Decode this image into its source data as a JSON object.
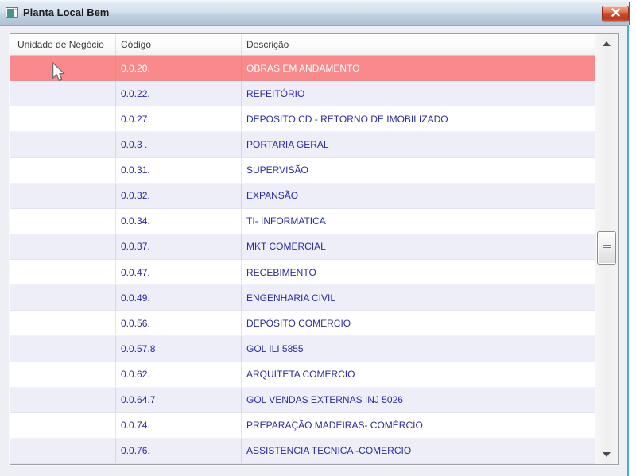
{
  "window": {
    "title": "Planta Local Bem",
    "close_icon": "close-x"
  },
  "table": {
    "columns": [
      "Unidade de Negócio",
      "Código",
      "Descrição"
    ],
    "rows": [
      {
        "unidade": "",
        "codigo": "0.0.20.",
        "descricao": "OBRAS EM ANDAMENTO",
        "selected": true
      },
      {
        "unidade": "",
        "codigo": "0.0.22.",
        "descricao": "REFEITÓRIO"
      },
      {
        "unidade": "",
        "codigo": "0.0.27.",
        "descricao": "DEPOSITO CD - RETORNO DE IMOBILIZADO"
      },
      {
        "unidade": "",
        "codigo": "0.0.3 .",
        "descricao": "PORTARIA GERAL"
      },
      {
        "unidade": "",
        "codigo": "0.0.31.",
        "descricao": "SUPERVISÃO"
      },
      {
        "unidade": "",
        "codigo": "0.0.32.",
        "descricao": "EXPANSÃO"
      },
      {
        "unidade": "",
        "codigo": "0.0.34.",
        "descricao": "TI- INFORMATICA"
      },
      {
        "unidade": "",
        "codigo": "0.0.37.",
        "descricao": "MKT COMERCIAL"
      },
      {
        "unidade": "",
        "codigo": "0.0.47.",
        "descricao": "RECEBIMENTO"
      },
      {
        "unidade": "",
        "codigo": "0.0.49.",
        "descricao": "ENGENHARIA CIVIL"
      },
      {
        "unidade": "",
        "codigo": "0.0.56.",
        "descricao": "DEPÓSITO COMERCIO"
      },
      {
        "unidade": "",
        "codigo": "0.0.57.8",
        "descricao": "GOL ILI 5855"
      },
      {
        "unidade": "",
        "codigo": "0.0.62.",
        "descricao": "ARQUITETA COMERCIO"
      },
      {
        "unidade": "",
        "codigo": "0.0.64.7",
        "descricao": "GOL VENDAS EXTERNAS INJ 5026"
      },
      {
        "unidade": "",
        "codigo": "0.0.74.",
        "descricao": "PREPARAÇÃO MADEIRAS- COMÉRCIO"
      },
      {
        "unidade": "",
        "codigo": "0.0.76.",
        "descricao": "ASSISTENCIA TECNICA -COMERCIO"
      }
    ]
  },
  "colors": {
    "selected_row": "#F9898B",
    "alt_row": "#EDEEF7",
    "row_text": "#2B2BA3",
    "selected_text": "#FFFFFF",
    "titlebar_top": "#F2F7FB",
    "titlebar_bottom": "#AFC3D6",
    "close_button": "#CE4A2C",
    "window_body": "#EDEFF4",
    "aero_accent": "#41B1D2"
  }
}
